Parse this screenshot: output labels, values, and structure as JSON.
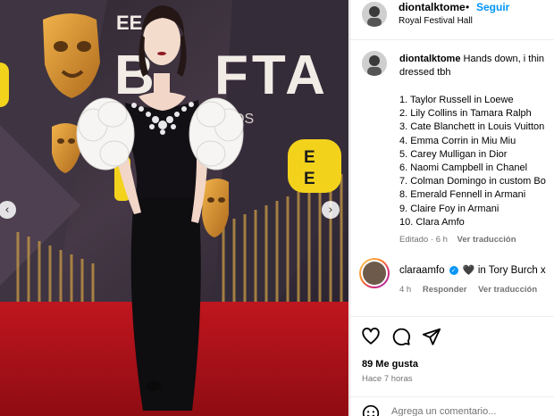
{
  "post": {
    "username": "diontalktome",
    "separator": "•",
    "follow_label": "Seguir",
    "location": "Royal Festival Hall"
  },
  "caption": {
    "username": "diontalktome",
    "text_line1": "Hands down, i thin",
    "text_line2": "dressed tbh",
    "list": [
      "1. Taylor Russell in Loewe",
      "2. Lily Collins in Tamara Ralph",
      "3. Cate Blanchett in Louis Vuitton",
      "4. Emma Corrin in Miu Miu",
      "5. Carey Mulligan in Dior",
      "6. Naomi Campbell in Chanel",
      "7. Colman Domingo in custom Bo",
      "8. Emerald Fennell in Armani",
      "9. Claire Foy in Armani",
      "10. Clara Amfo"
    ],
    "edited": "Editado",
    "separator": "·",
    "age": "6 h",
    "translate": "Ver traducción"
  },
  "comment": {
    "username": "claraamfo",
    "heart": "🖤",
    "text": "in Tory Burch x",
    "age": "4 h",
    "reply": "Responder",
    "translate": "Ver traducción"
  },
  "stats": {
    "likes": "89 Me gusta",
    "time": "Hace 7 horas",
    "add_comment_placeholder": "Agrega un comentario..."
  },
  "media": {
    "prev_arrow": "‹",
    "next_arrow": "›",
    "backdrop_brand_partial": "EE BAFTA",
    "sponsor": "EE",
    "colors": {
      "carpet": "#b3141c",
      "backdrop": "#3b3140",
      "gold": "#d89a3a",
      "ee_yellow": "#f3d21c"
    }
  },
  "icons": [
    "heart-icon",
    "comment-icon",
    "share-icon",
    "emoji-icon",
    "verified-icon"
  ]
}
